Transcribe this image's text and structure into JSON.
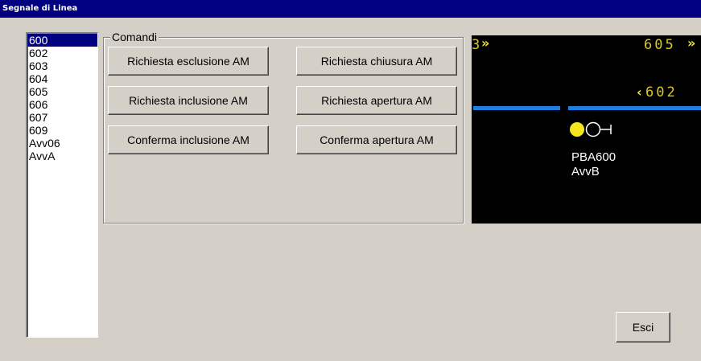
{
  "window": {
    "title": "Segnale di Linea"
  },
  "signal_list": {
    "items": [
      "600",
      "602",
      "603",
      "604",
      "605",
      "606",
      "607",
      "609",
      "Avv06",
      "AvvA"
    ],
    "selected_index": 0
  },
  "commands": {
    "group_title": "Comandi",
    "buttons": {
      "richiesta_esclusione": "Richiesta esclusione AM",
      "richiesta_chiusura": "Richiesta chiusura AM",
      "richiesta_inclusione": "Richiesta inclusione AM",
      "richiesta_apertura": "Richiesta apertura AM",
      "conferma_inclusione": "Conferma inclusione AM",
      "conferma_apertura": "Conferma apertura AM"
    }
  },
  "panel": {
    "left_partial_label": "3",
    "right_top_signal": "605",
    "right_mid_signal": "602",
    "signal_name": "PBA600",
    "signal_sub": "AvvB",
    "colors": {
      "track": "#1e7fe0",
      "lamp_on": "#f5e61e",
      "text_yellow": "#f0e028"
    },
    "arrow_glyphs": {
      "right": "»",
      "left": "‹"
    }
  },
  "footer": {
    "exit_label": "Esci"
  }
}
